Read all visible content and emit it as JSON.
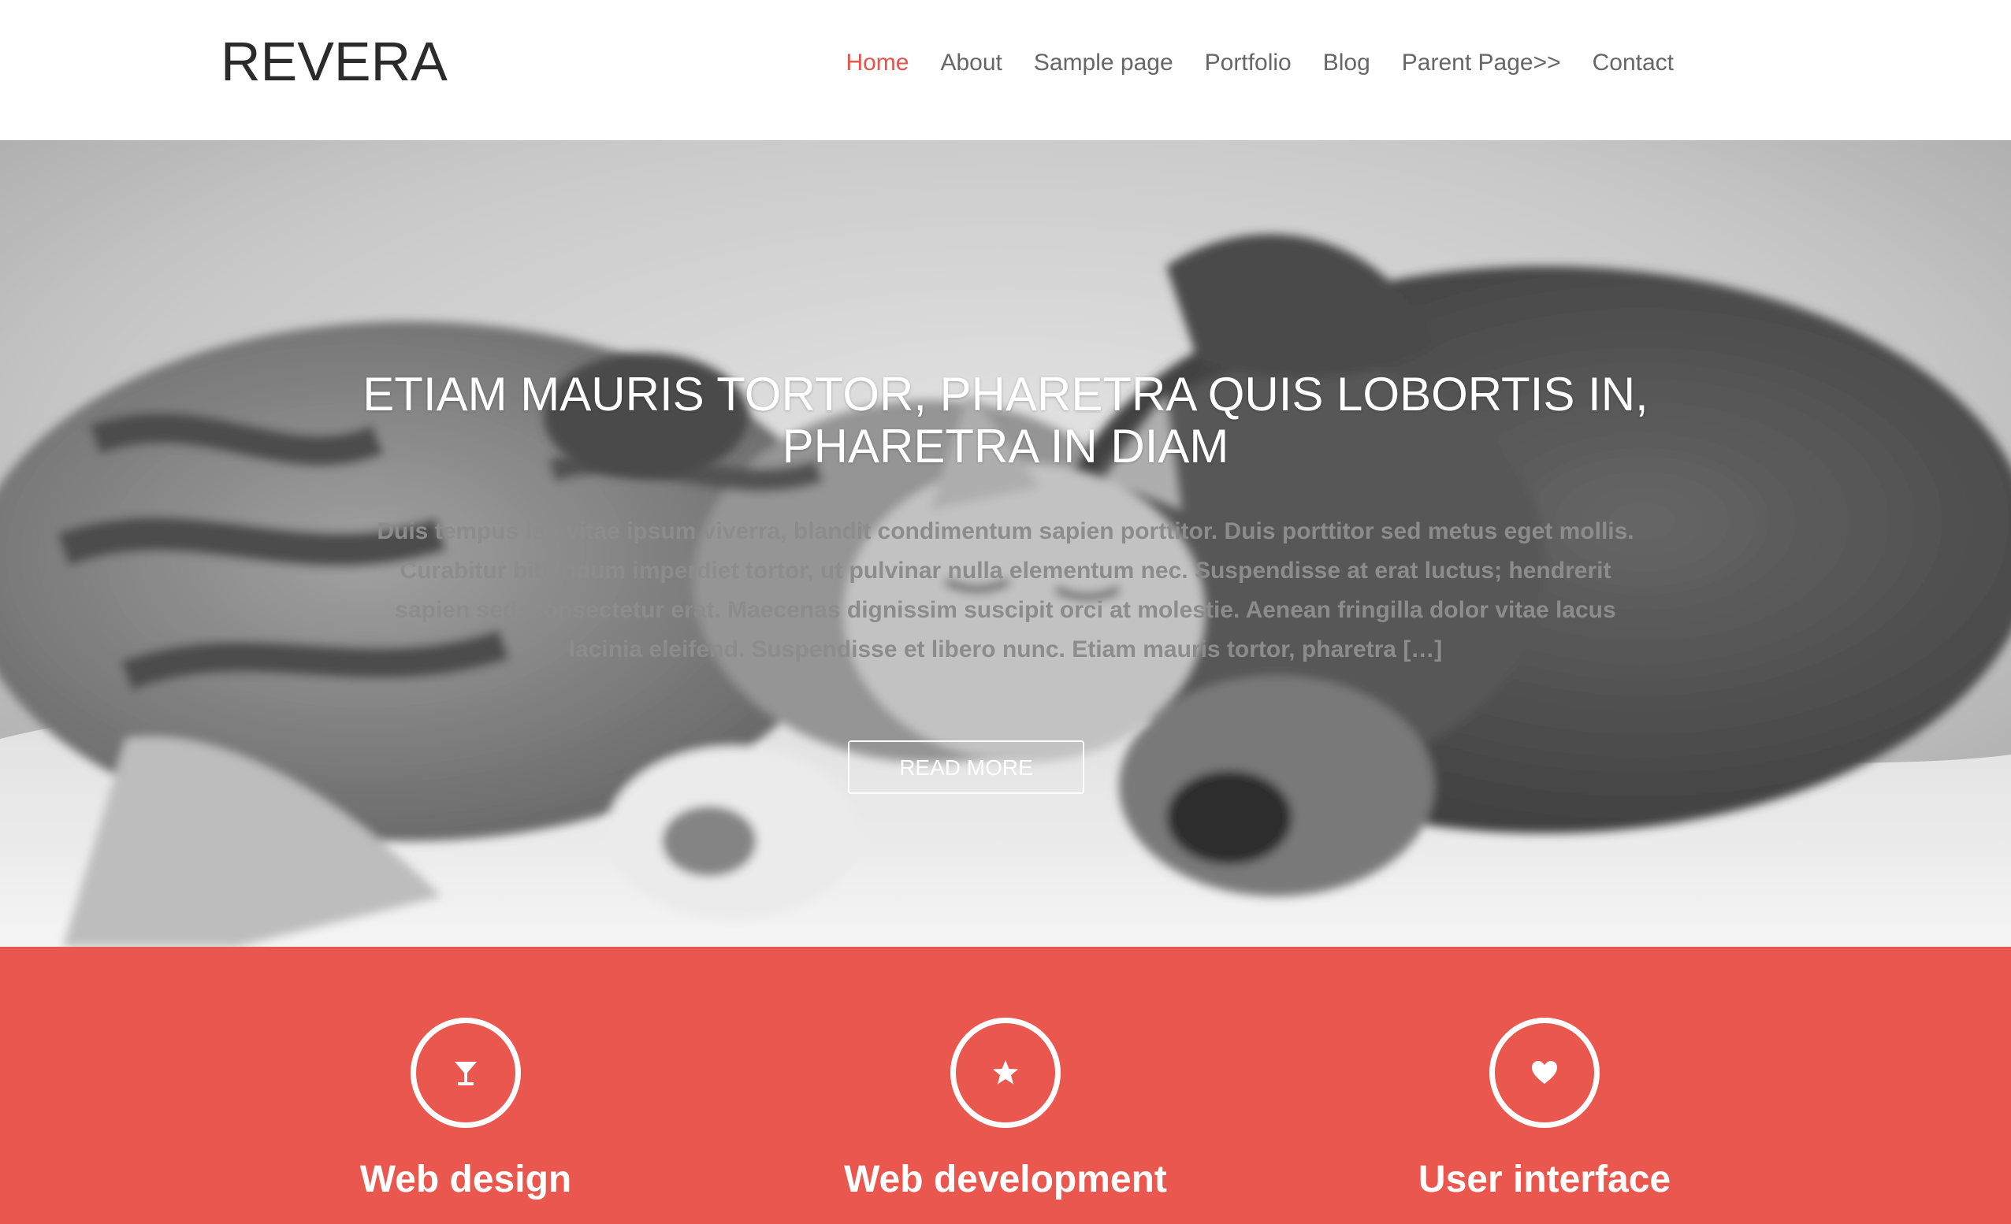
{
  "site": {
    "logo": "REVERA"
  },
  "nav": {
    "items": [
      {
        "label": "Home",
        "active": true
      },
      {
        "label": "About"
      },
      {
        "label": "Sample page"
      },
      {
        "label": "Portfolio"
      },
      {
        "label": "Blog"
      },
      {
        "label": "Parent Page>>"
      },
      {
        "label": "Contact"
      }
    ]
  },
  "hero": {
    "title": "ETIAM MAURIS TORTOR, PHARETRA QUIS LOBORTIS IN, PHARETRA IN DIAM",
    "excerpt": "Duis tempus leo vitae ipsum viverra, blandit condimentum sapien porttitor. Duis porttitor sed metus eget mollis. Curabitur bibendum imperdiet tortor, ut pulvinar nulla elementum nec. Suspendisse at erat luctus; hendrerit sapien sed, consectetur erat. Maecenas dignissim suscipit orci at molestie. Aenean fringilla dolor vitae lacus lacinia eleifend. Suspendisse et libero nunc. Etiam mauris tortor, pharetra […]",
    "button": "READ MORE",
    "image": "black-and-white photo of a kitten and puppy sleeping"
  },
  "services": [
    {
      "title": "Web design",
      "icon": "cocktail-glass-icon"
    },
    {
      "title": "Web development",
      "icon": "star-icon"
    },
    {
      "title": "User interface",
      "icon": "heart-icon"
    }
  ],
  "colors": {
    "accent": "#e9574f",
    "nav_active": "#e5534b",
    "logo": "#2b2b2b",
    "nav_text": "#666666"
  }
}
